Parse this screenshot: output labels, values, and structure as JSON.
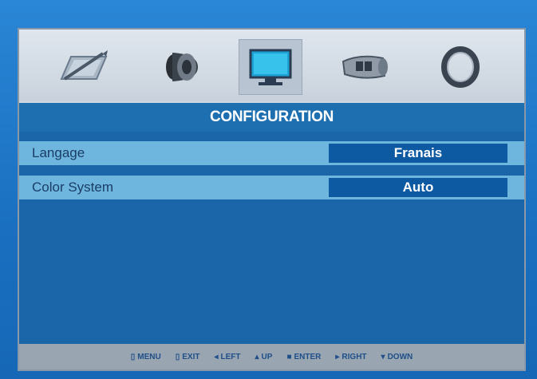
{
  "menu": {
    "icons": [
      {
        "name": "picture-icon"
      },
      {
        "name": "sound-icon"
      },
      {
        "name": "display-icon",
        "active": true
      },
      {
        "name": "timer-icon"
      },
      {
        "name": "setup-icon"
      }
    ],
    "title": "CONFIGURATION",
    "rows": [
      {
        "label": "Langage",
        "value": "Franais"
      },
      {
        "label": "Color System",
        "value": "Auto"
      }
    ]
  },
  "footer": {
    "hints": [
      {
        "glyph": "▯",
        "text": "MENU"
      },
      {
        "glyph": "▯",
        "text": "EXIT"
      },
      {
        "glyph": "◂",
        "text": "LEFT"
      },
      {
        "glyph": "▴",
        "text": "UP"
      },
      {
        "glyph": "■",
        "text": "ENTER"
      },
      {
        "glyph": "▸",
        "text": "RIGHT"
      },
      {
        "glyph": "▾",
        "text": "DOWN"
      }
    ]
  },
  "colors": {
    "title_bar": "#1d6fb0",
    "row_bg": "#6fb6df",
    "value_bg": "#0e5aa2",
    "menu_bg": "#1a66a8",
    "footer_bg": "#9aa5b2",
    "footer_text": "#1e4f88"
  }
}
